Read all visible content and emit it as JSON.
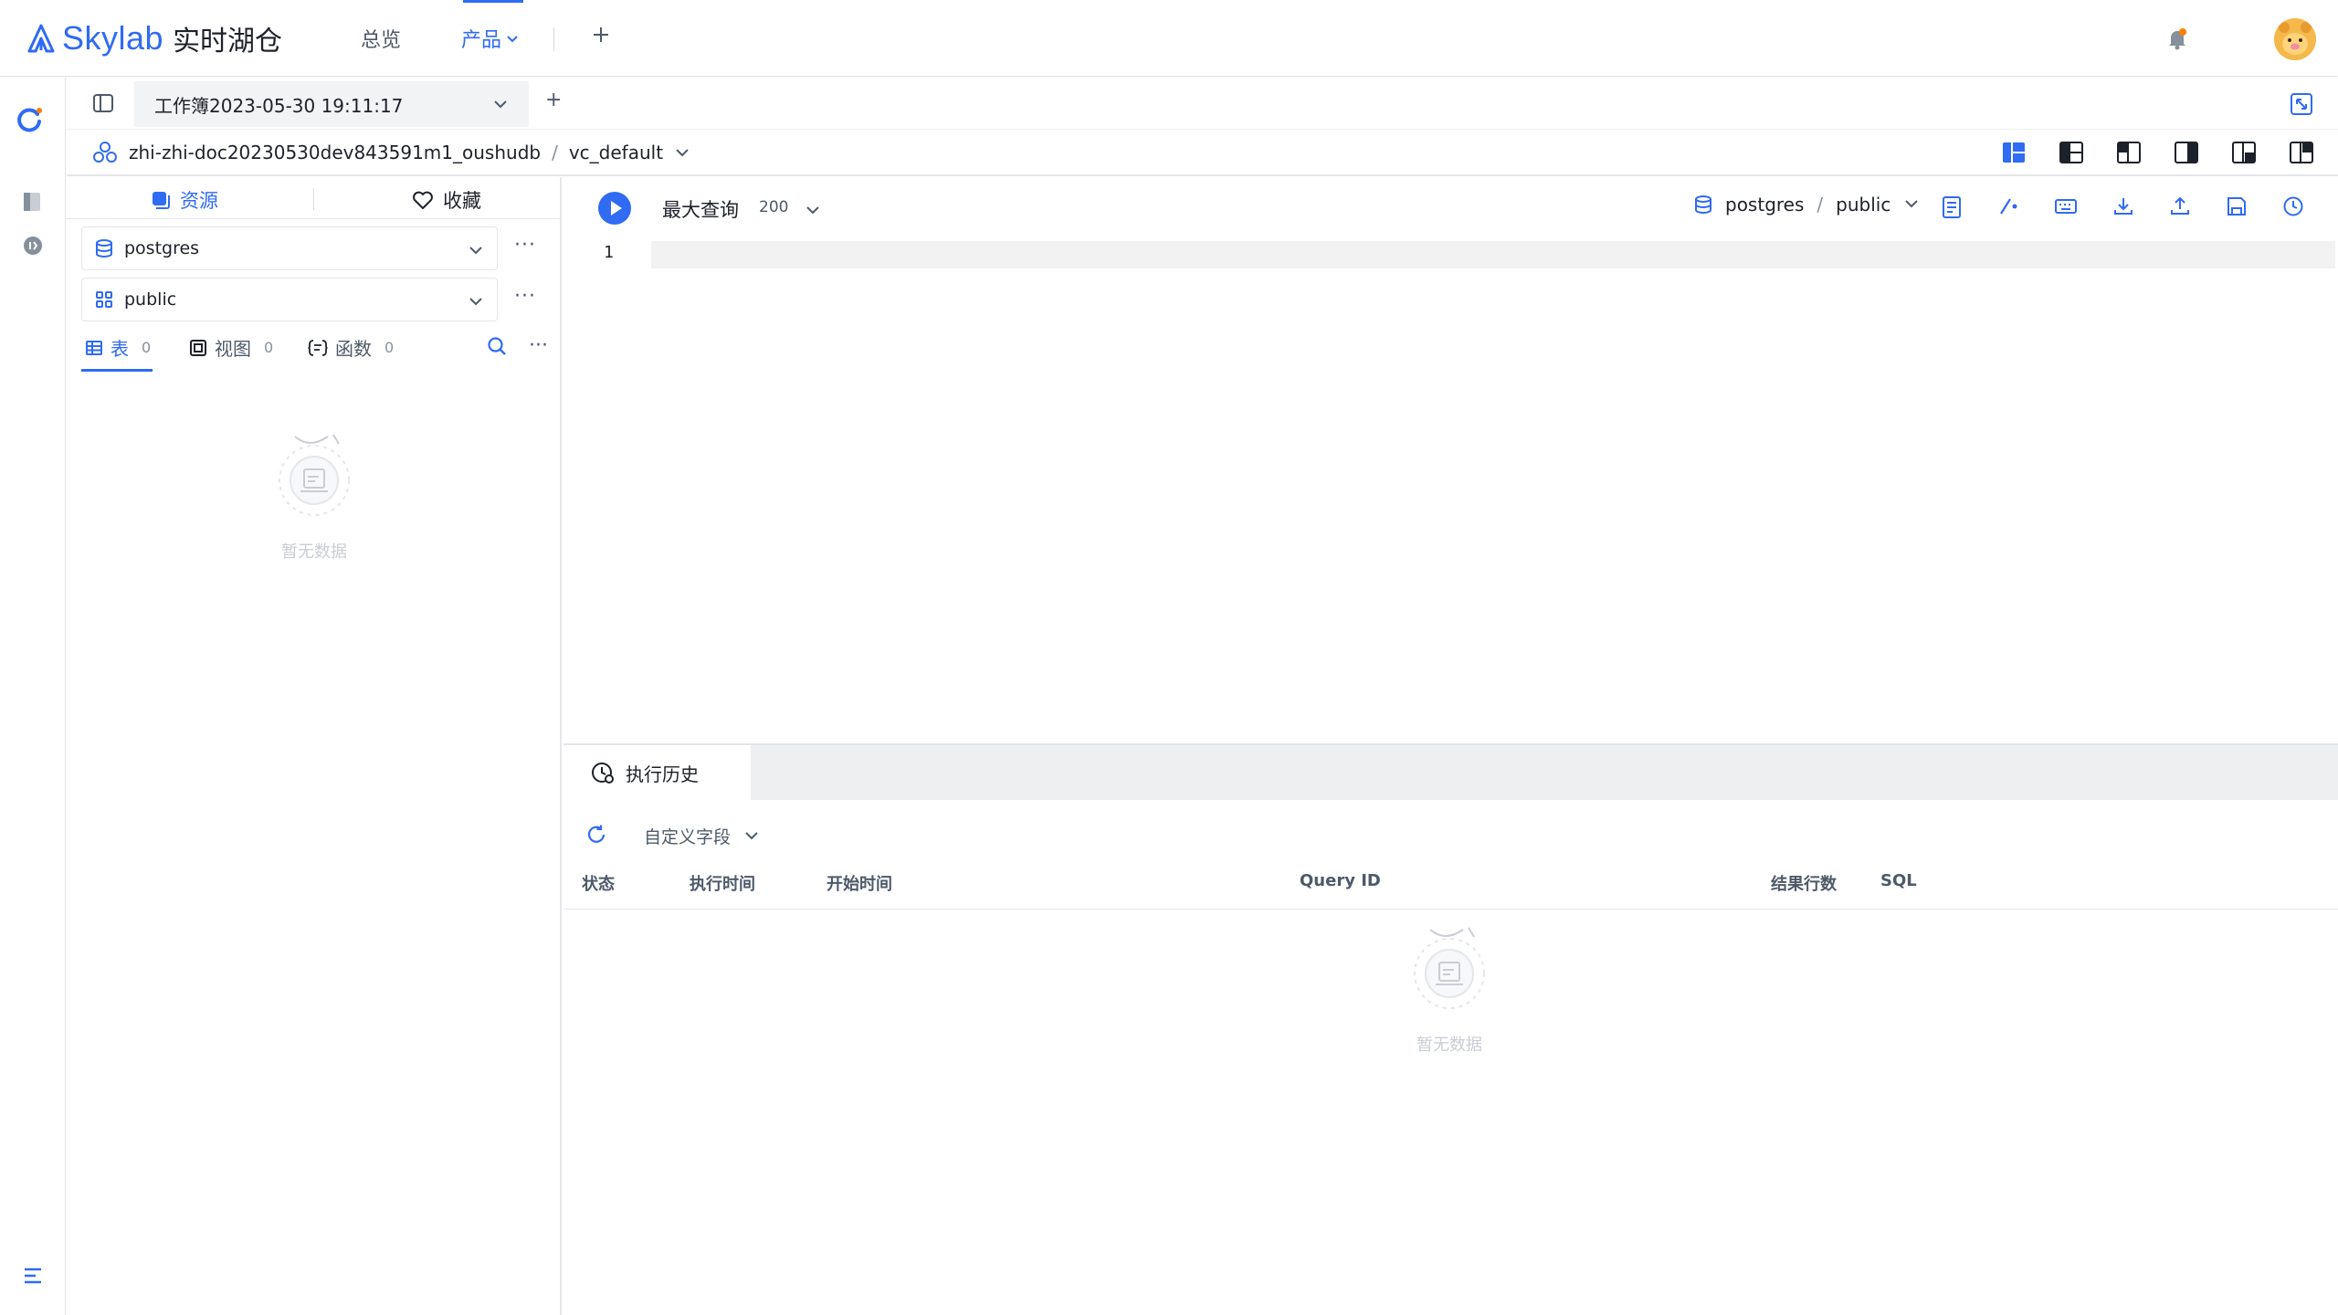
{
  "header": {
    "brand": "Skylab",
    "brand_cn": "实时湖仓",
    "nav": {
      "overview": "总览",
      "products": "产品"
    }
  },
  "workbook": {
    "tab_title": "工作簿2023-05-30 19:11:17",
    "add_tab": "+"
  },
  "breadcrumb": {
    "instance": "zhi-zhi-doc20230530dev843591m1_oushudb",
    "separator": "/",
    "vc": "vc_default"
  },
  "left_panel": {
    "tabs": {
      "resources": "资源",
      "favorites": "收藏"
    },
    "database": "postgres",
    "schema": "public",
    "more": "···",
    "object_tabs": [
      {
        "label": "表",
        "count": "0"
      },
      {
        "label": "视图",
        "count": "0"
      },
      {
        "label": "函数",
        "count": "0"
      }
    ],
    "empty_text": "暂无数据"
  },
  "editor": {
    "max_query_label": "最大查询",
    "max_query_value": "200",
    "context_db": "postgres",
    "context_schema": "public",
    "context_sep": "/",
    "line_number": "1"
  },
  "history": {
    "tab_label": "执行历史",
    "custom_fields": "自定义字段",
    "columns": [
      "状态",
      "执行时间",
      "开始时间",
      "Query ID",
      "结果行数",
      "SQL"
    ],
    "empty_text": "暂无数据"
  },
  "colors": {
    "accent": "#2f6bf3",
    "border": "#e5e6eb",
    "muted": "#86909c"
  }
}
